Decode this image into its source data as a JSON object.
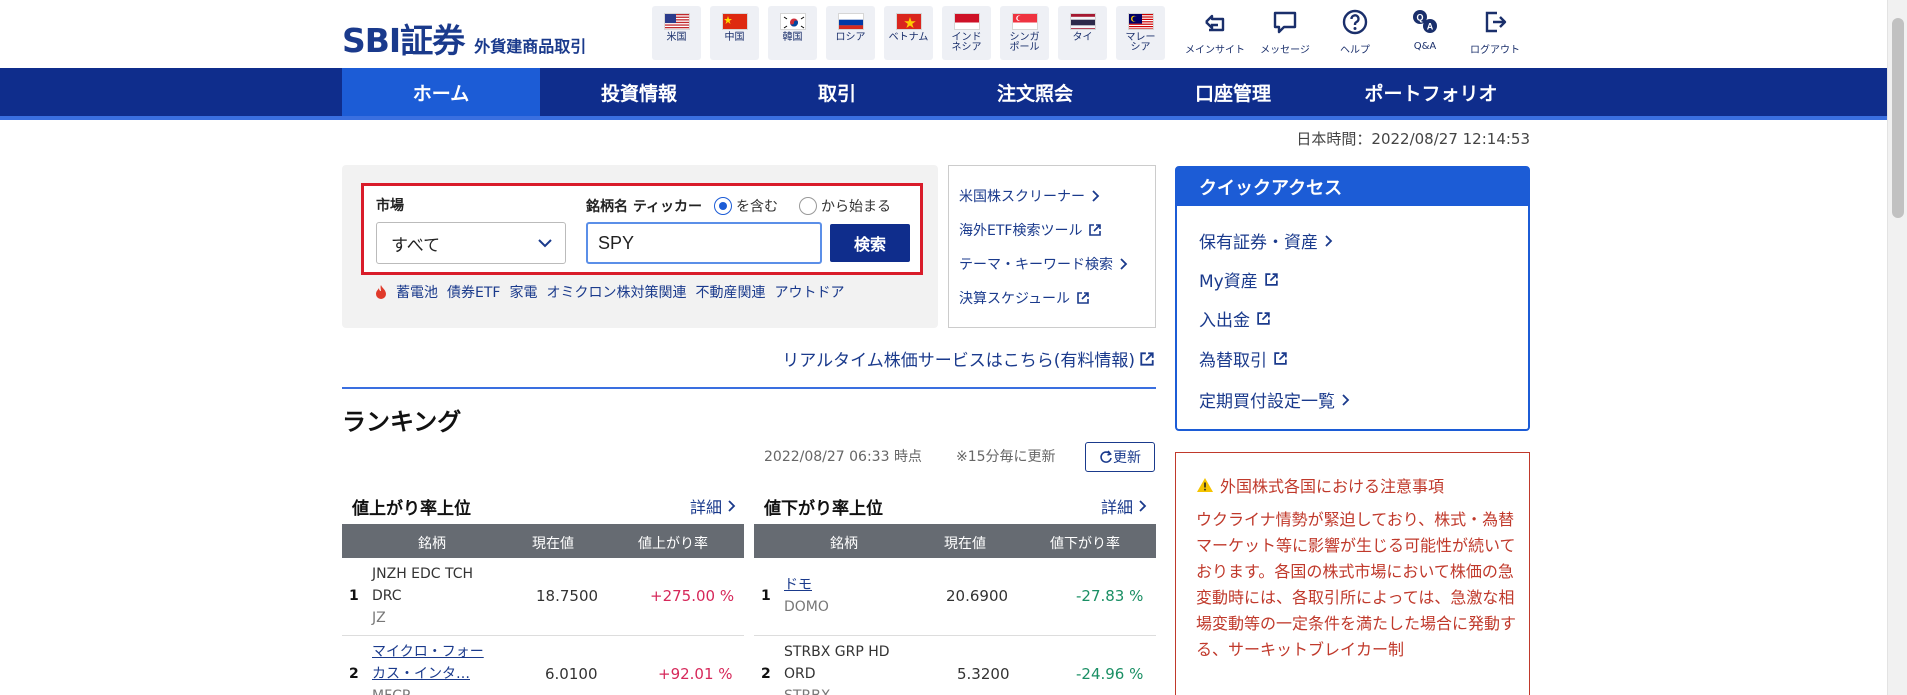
{
  "header": {
    "logo_main": "SBI証券",
    "logo_sub": "外貨建商品取引"
  },
  "flags": [
    {
      "label": "米国",
      "icon": "us-flag-icon"
    },
    {
      "label": "中国",
      "icon": "china-flag-icon"
    },
    {
      "label": "韓国",
      "icon": "korea-flag-icon"
    },
    {
      "label": "ロシア",
      "icon": "russia-flag-icon"
    },
    {
      "label": "ベトナム",
      "icon": "vietnam-flag-icon"
    },
    {
      "label": "インド\nネシア",
      "icon": "indonesia-flag-icon"
    },
    {
      "label": "シンガ\nポール",
      "icon": "singapore-flag-icon"
    },
    {
      "label": "タイ",
      "icon": "thailand-flag-icon"
    },
    {
      "label": "マレー\nシア",
      "icon": "malaysia-flag-icon"
    }
  ],
  "utils": [
    {
      "label": "メインサイト",
      "icon": "main-site-icon"
    },
    {
      "label": "メッセージ",
      "icon": "message-icon"
    },
    {
      "label": "ヘルプ",
      "icon": "help-icon"
    },
    {
      "label": "Q&A",
      "icon": "qa-icon"
    },
    {
      "label": "ログアウト",
      "icon": "logout-icon"
    }
  ],
  "nav": {
    "items": [
      "ホーム",
      "投資情報",
      "取引",
      "注文照会",
      "口座管理",
      "ポートフォリオ"
    ],
    "active": "ホーム"
  },
  "jst": "日本時間：2022/08/27 12:14:53",
  "search": {
    "market_label": "市場",
    "market_value": "すべて",
    "name_label": "銘柄名 ティッカー",
    "radio_contains": "を含む",
    "radio_starts": "から始まる",
    "radio_selected": "を含む",
    "input_value": "SPY",
    "button": "検索",
    "keywords": [
      "蓄電池",
      "債券ETF",
      "家電",
      "オミクロン株対策関連",
      "不動産関連",
      "アウトドア"
    ]
  },
  "tools": [
    "米国株スクリーナー",
    "海外ETF検索ツール",
    "テーマ・キーワード検索",
    "決算スケジュール"
  ],
  "realtime_link": "リアルタイム株価サービスはこちら(有料情報)",
  "ranking": {
    "title": "ランキング",
    "update_time": "2022/08/27 06:33 時点",
    "update_note": "※15分毎に更新",
    "update_button": "更新",
    "detail_label": "詳細",
    "gainers": {
      "title": "値上がり率上位",
      "headers": [
        "銘柄",
        "現在値",
        "値上がり率"
      ],
      "rows": [
        {
          "rank": "1",
          "name_line1": "JNZH EDC TCH",
          "name_line2": "DRC",
          "code": "JZ",
          "price": "18.7500",
          "pct": "+275.00 %"
        },
        {
          "rank": "2",
          "name_line1": "マイクロ・フォー",
          "name_line2": "カス・インタ…",
          "code": "MFCP",
          "price": "6.0100",
          "pct": "+92.01 %"
        }
      ]
    },
    "losers": {
      "title": "値下がり率上位",
      "headers": [
        "銘柄",
        "現在値",
        "値下がり率"
      ],
      "rows": [
        {
          "rank": "1",
          "name_line1": "ドモ",
          "name_line2": "",
          "code": "DOMO",
          "price": "20.6900",
          "pct": "-27.83 %"
        },
        {
          "rank": "2",
          "name_line1": "STRBX GRP HD",
          "name_line2": "ORD",
          "code": "STRBX",
          "price": "5.3200",
          "pct": "-24.96 %"
        }
      ]
    }
  },
  "quick_access": {
    "title": "クイックアクセス",
    "items": [
      "保有証券・資産",
      "My資産",
      "入出金",
      "為替取引",
      "定期買付設定一覧"
    ]
  },
  "notice": {
    "title": "外国株式各国における注意事項",
    "body": "ウクライナ情勢が緊迫しており、株式・為替マーケット等に影響が生じる可能性が続いております。各国の株式市場において株価の急変動時には、各取引所によっては、急激な相場変動等の一定条件を満たした場合に発動する、サーキットブレイカー制"
  },
  "colors": {
    "brand_navy": "#0f2d8c",
    "active_blue": "#1c5cd6",
    "highlight_red": "#d91c2a",
    "up_color": "#d6285a",
    "down_color": "#1a8f64"
  }
}
